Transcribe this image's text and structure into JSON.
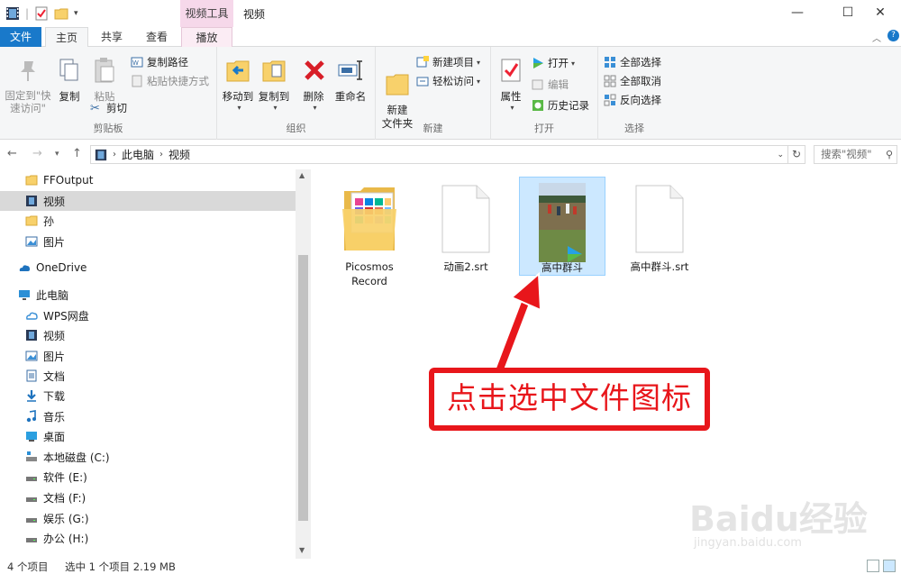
{
  "window": {
    "title": "视频",
    "context_tab_header": "视频工具",
    "colors": {
      "accent": "#1979ca",
      "context": "#f6d8ea",
      "selection": "#cce8ff",
      "annotation": "#e8161b"
    }
  },
  "tabs": {
    "file": "文件",
    "home": "主页",
    "share": "共享",
    "view": "查看",
    "play": "播放"
  },
  "ribbon": {
    "clipboard": {
      "label": "剪贴板",
      "pin": "固定到\"快速访问\"",
      "copy": "复制",
      "paste": "粘贴",
      "copy_path": "复制路径",
      "paste_shortcut": "粘贴快捷方式",
      "cut": "剪切"
    },
    "organize": {
      "label": "组织",
      "move_to": "移动到",
      "copy_to": "复制到",
      "delete": "删除",
      "rename": "重命名"
    },
    "new": {
      "label": "新建",
      "new_folder": "新建\n文件夹",
      "new_item": "新建项目",
      "easy_access": "轻松访问"
    },
    "open": {
      "label": "打开",
      "properties": "属性",
      "open": "打开",
      "edit": "编辑",
      "history": "历史记录"
    },
    "select": {
      "label": "选择",
      "select_all": "全部选择",
      "select_none": "全部取消",
      "invert": "反向选择"
    }
  },
  "address": {
    "crumbs": [
      "此电脑",
      "视频"
    ],
    "search_placeholder": "搜索\"视频\""
  },
  "sidebar": {
    "items": [
      {
        "label": "FFOutput",
        "icon": "folder-icon"
      },
      {
        "label": "视频",
        "icon": "video-folder-icon",
        "selected": true
      },
      {
        "label": "孙",
        "icon": "folder-icon"
      },
      {
        "label": "图片",
        "icon": "pictures-icon"
      },
      {
        "label": "OneDrive",
        "icon": "onedrive-icon"
      },
      {
        "label": "此电脑",
        "icon": "pc-icon"
      },
      {
        "label": "WPS网盘",
        "icon": "cloud-icon"
      },
      {
        "label": "视频",
        "icon": "video-folder-icon"
      },
      {
        "label": "图片",
        "icon": "pictures-icon"
      },
      {
        "label": "文档",
        "icon": "documents-icon"
      },
      {
        "label": "下载",
        "icon": "download-icon"
      },
      {
        "label": "音乐",
        "icon": "music-icon"
      },
      {
        "label": "桌面",
        "icon": "desktop-icon"
      },
      {
        "label": "本地磁盘 (C:)",
        "icon": "system-drive-icon"
      },
      {
        "label": "软件 (E:)",
        "icon": "drive-icon"
      },
      {
        "label": "文档 (F:)",
        "icon": "drive-icon"
      },
      {
        "label": "娱乐 (G:)",
        "icon": "drive-icon"
      },
      {
        "label": "办公 (H:)",
        "icon": "drive-icon"
      }
    ]
  },
  "files": [
    {
      "name": "Picosmos\nRecord",
      "type": "folder"
    },
    {
      "name": "动画2.srt",
      "type": "document"
    },
    {
      "name": "高中群斗",
      "type": "video",
      "selected": true
    },
    {
      "name": "高中群斗.srt",
      "type": "document"
    }
  ],
  "annotation": {
    "text": "点击选中文件图标"
  },
  "watermark": {
    "logo": "Baidu经验",
    "url": "jingyan.baidu.com"
  },
  "status": {
    "count": "4 个项目",
    "selection": "选中 1 个项目  2.19 MB"
  }
}
